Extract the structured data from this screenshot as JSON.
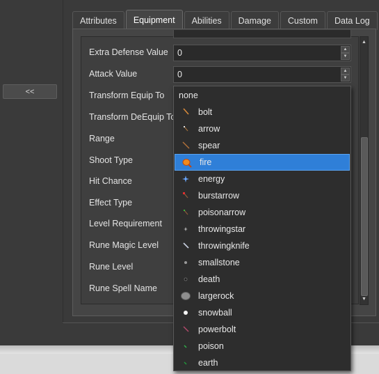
{
  "nav": {
    "back_label": "<<"
  },
  "tabs": [
    {
      "label": "Attributes"
    },
    {
      "label": "Equipment",
      "active": true
    },
    {
      "label": "Abilities"
    },
    {
      "label": "Damage"
    },
    {
      "label": "Custom"
    },
    {
      "label": "Data Log"
    }
  ],
  "fields": {
    "extra_defense": {
      "label": "Extra Defense Value",
      "value": "0"
    },
    "attack": {
      "label": "Attack Value",
      "value": "0"
    },
    "transform_equip": {
      "label": "Transform Equip To"
    },
    "transform_deequip": {
      "label": "Transform DeEquip To"
    },
    "range": {
      "label": "Range"
    },
    "shoot_type": {
      "label": "Shoot Type"
    },
    "hit_chance": {
      "label": "Hit Chance"
    },
    "effect_type": {
      "label": "Effect Type"
    },
    "level_requirement": {
      "label": "Level Requirement"
    },
    "rune_magic_level": {
      "label": "Rune Magic Level"
    },
    "rune_level": {
      "label": "Rune Level"
    },
    "rune_spell_name": {
      "label": "Rune Spell Name"
    }
  },
  "dropdown": {
    "selected": "fire",
    "options": [
      {
        "label": "none",
        "icon": ""
      },
      {
        "label": "bolt",
        "icon": "bolt-icon"
      },
      {
        "label": "arrow",
        "icon": "arrow-icon"
      },
      {
        "label": "spear",
        "icon": "spear-icon"
      },
      {
        "label": "fire",
        "icon": "fire-icon"
      },
      {
        "label": "energy",
        "icon": "energy-icon"
      },
      {
        "label": "burstarrow",
        "icon": "burstarrow-icon"
      },
      {
        "label": "poisonarrow",
        "icon": "poisonarrow-icon"
      },
      {
        "label": "throwingstar",
        "icon": "throwingstar-icon"
      },
      {
        "label": "throwingknife",
        "icon": "throwingknife-icon"
      },
      {
        "label": "smallstone",
        "icon": "smallstone-icon"
      },
      {
        "label": "death",
        "icon": "death-icon"
      },
      {
        "label": "largerock",
        "icon": "largerock-icon"
      },
      {
        "label": "snowball",
        "icon": "snowball-icon"
      },
      {
        "label": "powerbolt",
        "icon": "powerbolt-icon"
      },
      {
        "label": "poison",
        "icon": "poison-icon"
      },
      {
        "label": "earth",
        "icon": "earth-icon"
      }
    ]
  },
  "colors": {
    "background": "#3a3a3a",
    "selection": "#2f7fd8",
    "field": "#2a2a2a"
  }
}
